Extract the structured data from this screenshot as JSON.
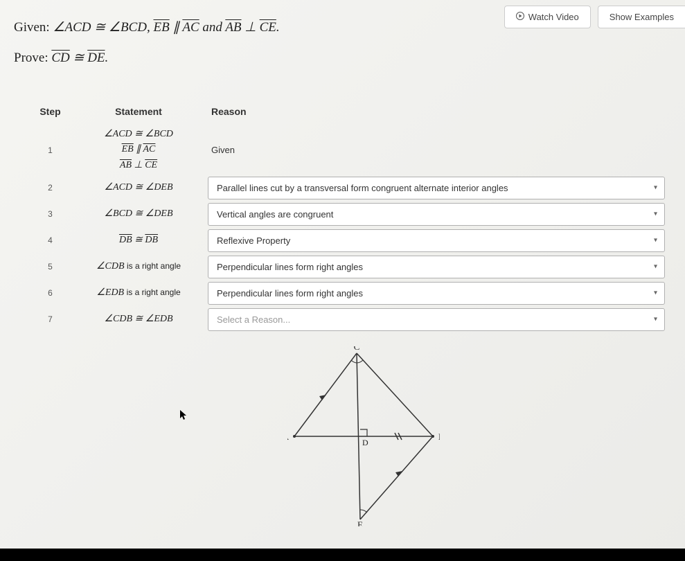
{
  "buttons": {
    "watch_video": "Watch Video",
    "show_examples": "Show Examples"
  },
  "problem": {
    "given_label": "Given:",
    "given_math": "∠ACD ≅ ∠BCD, E͞B ∥ A͞C and A͞B ⊥ C͞E.",
    "prove_label": "Prove:",
    "prove_math": "C͞D ≅ D͞E."
  },
  "headers": {
    "step": "Step",
    "statement": "Statement",
    "reason": "Reason"
  },
  "rows": [
    {
      "step": "1",
      "statement_lines": [
        "∠ACD ≅ ∠BCD",
        "E͞B ∥ A͞C",
        "A͞B ⊥ C͞E"
      ],
      "reason": "Given",
      "reason_type": "plain"
    },
    {
      "step": "2",
      "statement_lines": [
        "∠ACD ≅ ∠DEB"
      ],
      "reason": "Parallel lines cut by a transversal form congruent alternate interior angles",
      "reason_type": "dropdown"
    },
    {
      "step": "3",
      "statement_lines": [
        "∠BCD ≅ ∠DEB"
      ],
      "reason": "Vertical angles are congruent",
      "reason_type": "dropdown"
    },
    {
      "step": "4",
      "statement_lines": [
        "D͞B ≅ D͞B"
      ],
      "reason": "Reflexive Property",
      "reason_type": "dropdown"
    },
    {
      "step": "5",
      "statement_lines": [
        "∠CDB is a right angle"
      ],
      "reason": "Perpendicular lines form right angles",
      "reason_type": "dropdown"
    },
    {
      "step": "6",
      "statement_lines": [
        "∠EDB is a right angle"
      ],
      "reason": "Perpendicular lines form right angles",
      "reason_type": "dropdown"
    },
    {
      "step": "7",
      "statement_lines": [
        "∠CDB ≅ ∠EDB"
      ],
      "reason": "Select a Reason...",
      "reason_type": "dropdown-placeholder"
    }
  ],
  "figure": {
    "vertices": {
      "A": "A",
      "B": "B",
      "C": "C",
      "D": "D",
      "E": "E"
    }
  }
}
